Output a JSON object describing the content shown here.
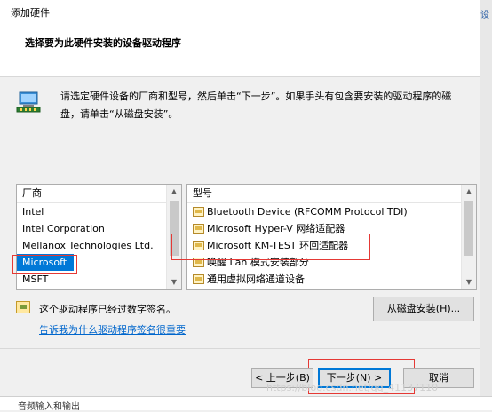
{
  "window": {
    "title": "添加硬件",
    "edge_glyph": "设"
  },
  "header": {
    "title": "选择要为此硬件安装的设备驱动程序"
  },
  "instruction": "请选定硬件设备的厂商和型号，然后单击“下一步”。如果手头有包含要安装的驱动程序的磁盘，请单击“从磁盘安装”。",
  "manufacturer_list": {
    "header": "厂商",
    "items": [
      "Intel",
      "Intel Corporation",
      "Mellanox Technologies Ltd.",
      "Microsoft",
      "MSFT"
    ],
    "selected": "Microsoft"
  },
  "model_list": {
    "header": "型号",
    "items": [
      "Bluetooth Device (RFCOMM Protocol TDI)",
      "Microsoft Hyper-V 网络适配器",
      "Microsoft KM-TEST 环回适配器",
      "唤醒 Lan 模式安装部分",
      "通用虚拟网络通道设备"
    ],
    "highlighted": "Microsoft KM-TEST 环回适配器"
  },
  "signature": {
    "status": "这个驱动程序已经过数字签名。",
    "link": "告诉我为什么驱动程序签名很重要"
  },
  "buttons": {
    "have_disk": "从磁盘安装(H)...",
    "back": "< 上一步(B)",
    "next": "下一步(N) >",
    "cancel": "取消"
  },
  "background_text": "音频输入和输出",
  "watermark": "https://blog.csdn.net/qq_41137110",
  "colors": {
    "selection": "#0078d7",
    "annotation": "#e53935",
    "link": "#0066cc"
  }
}
